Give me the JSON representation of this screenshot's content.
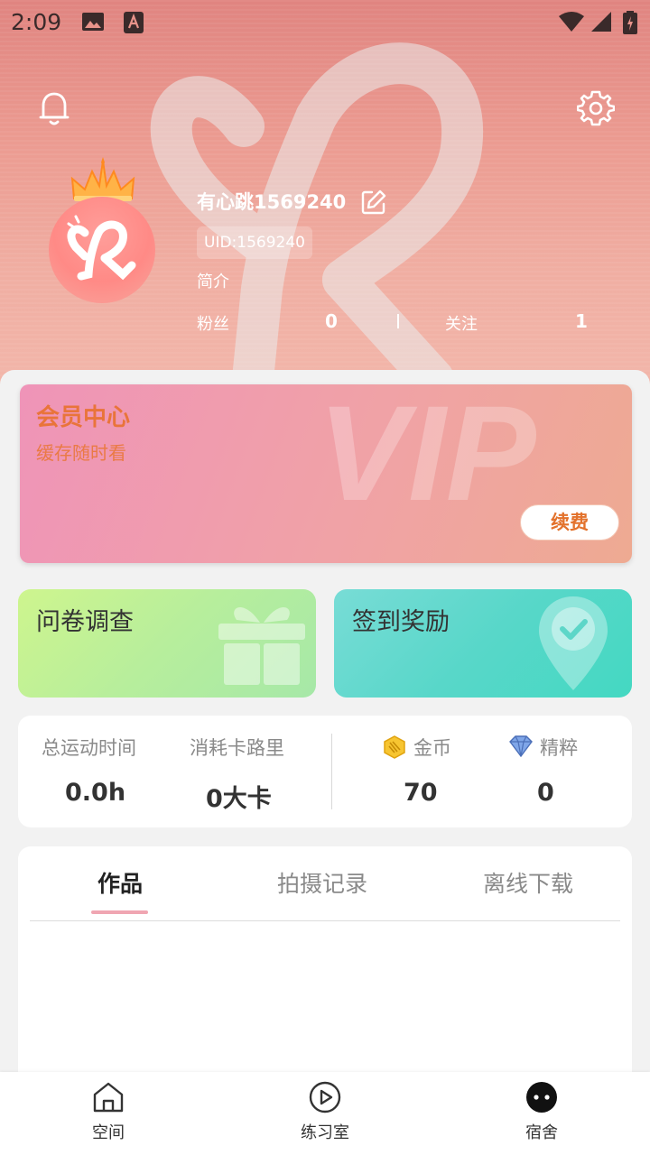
{
  "status_bar": {
    "time": "2:09"
  },
  "profile": {
    "username": "有心跳1569240",
    "uid": "UID:1569240",
    "intro": "简介",
    "followers_label": "粉丝",
    "followers_count": "0",
    "following_label": "关注",
    "following_count": "1"
  },
  "vip": {
    "title": "会员中心",
    "subtitle": "缓存随时看",
    "watermark": "VIP",
    "renew_label": "续费"
  },
  "quick_actions": [
    {
      "label": "问卷调查",
      "icon": "gift-icon"
    },
    {
      "label": "签到奖励",
      "icon": "location-check-icon"
    }
  ],
  "stats": [
    {
      "label": "总运动时间",
      "value": "0.0h"
    },
    {
      "label": "消耗卡路里",
      "value": "0大卡"
    },
    {
      "label": "金币",
      "value": "70",
      "icon": "coin-icon"
    },
    {
      "label": "精粹",
      "value": "0",
      "icon": "gem-icon"
    }
  ],
  "tabs": [
    {
      "label": "作品",
      "active": true
    },
    {
      "label": "拍摄记录",
      "active": false
    },
    {
      "label": "离线下载",
      "active": false
    }
  ],
  "bottom_nav": [
    {
      "label": "空间",
      "icon": "home-icon"
    },
    {
      "label": "练习室",
      "icon": "play-circle-icon"
    },
    {
      "label": "宿舍",
      "icon": "dorm-face-icon",
      "active": true
    }
  ],
  "colors": {
    "vip_accent": "#e9743a",
    "tab_indicator": "#f0a6b2",
    "survey_card": "#bdf09a",
    "checkin_card": "#52d8c8"
  }
}
